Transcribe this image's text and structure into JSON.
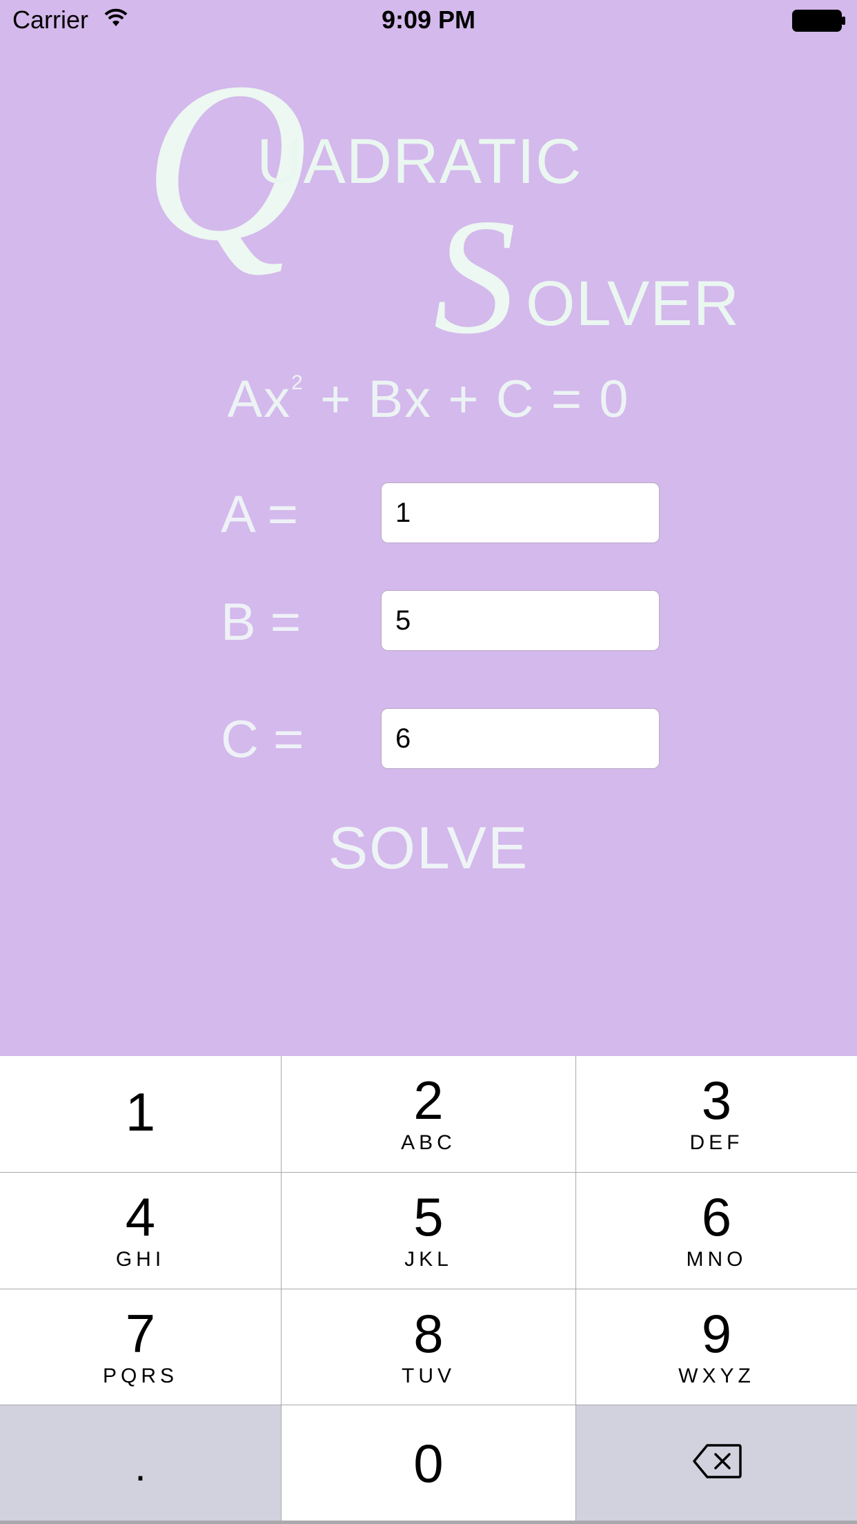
{
  "status_bar": {
    "carrier": "Carrier",
    "time": "9:09 PM"
  },
  "title": {
    "q_cap": "Q",
    "q_rest": "UADRATIC",
    "s_cap": "S",
    "s_rest": "OLVER"
  },
  "equation": {
    "part1": "Ax",
    "exponent": "2",
    "part2": " + Bx + C = 0"
  },
  "fields": {
    "a": {
      "label": "A =",
      "value": "1"
    },
    "b": {
      "label": "B =",
      "value": "5"
    },
    "c": {
      "label": "C =",
      "value": "6"
    }
  },
  "solve_label": "SOLVE",
  "keypad": {
    "k1": {
      "digit": "1",
      "letters": ""
    },
    "k2": {
      "digit": "2",
      "letters": "ABC"
    },
    "k3": {
      "digit": "3",
      "letters": "DEF"
    },
    "k4": {
      "digit": "4",
      "letters": "GHI"
    },
    "k5": {
      "digit": "5",
      "letters": "JKL"
    },
    "k6": {
      "digit": "6",
      "letters": "MNO"
    },
    "k7": {
      "digit": "7",
      "letters": "PQRS"
    },
    "k8": {
      "digit": "8",
      "letters": "TUV"
    },
    "k9": {
      "digit": "9",
      "letters": "WXYZ"
    },
    "dot": ".",
    "k0": {
      "digit": "0"
    },
    "delete_icon": "backspace-icon"
  },
  "colors": {
    "background": "#d4b9ec",
    "title_text": "#ecf8f1",
    "keypad_dark": "#d2d2de"
  }
}
